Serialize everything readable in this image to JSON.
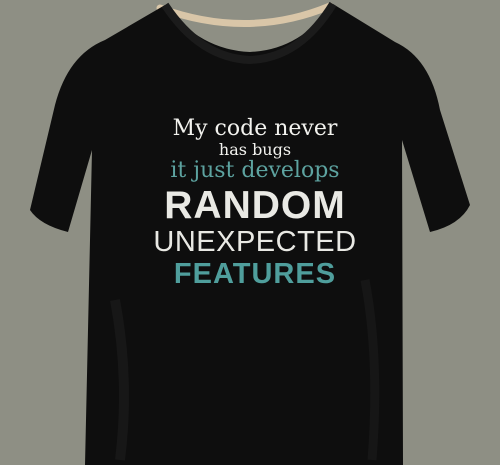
{
  "print": {
    "line1": "My code never",
    "line2": "has bugs",
    "line3": "it just develops",
    "line4": "RANDOM",
    "line5": "UNEXPECTED",
    "line6": "FEATURES"
  },
  "colors": {
    "background": "#8e8f84",
    "shirt": "#0e0e0e",
    "text_white": "#f2f2ee",
    "text_teal": "#5da3a0"
  }
}
